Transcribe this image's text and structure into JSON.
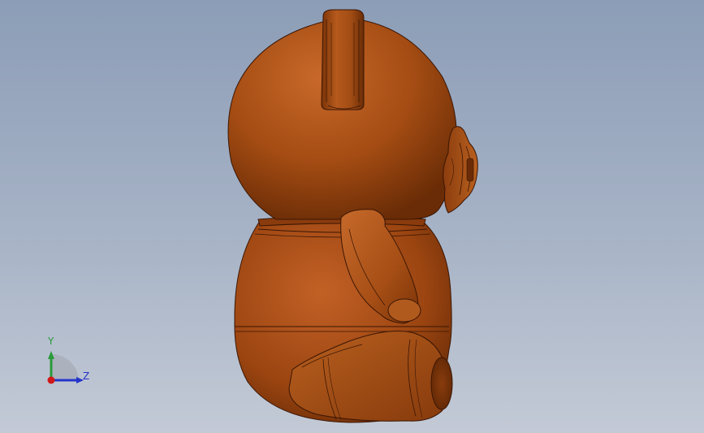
{
  "viewport": {
    "background_top": "#8c9db7",
    "background_bottom": "#c3cad6"
  },
  "model": {
    "name": "teddy-bear-part",
    "view": "right",
    "body_color": "#a04a12",
    "edge_color": "#3a1604"
  },
  "triad": {
    "y_label": "Y",
    "z_label": "Z",
    "y_color": "#2a9a3a",
    "z_color": "#2434c8",
    "x_color": "#d01818"
  }
}
